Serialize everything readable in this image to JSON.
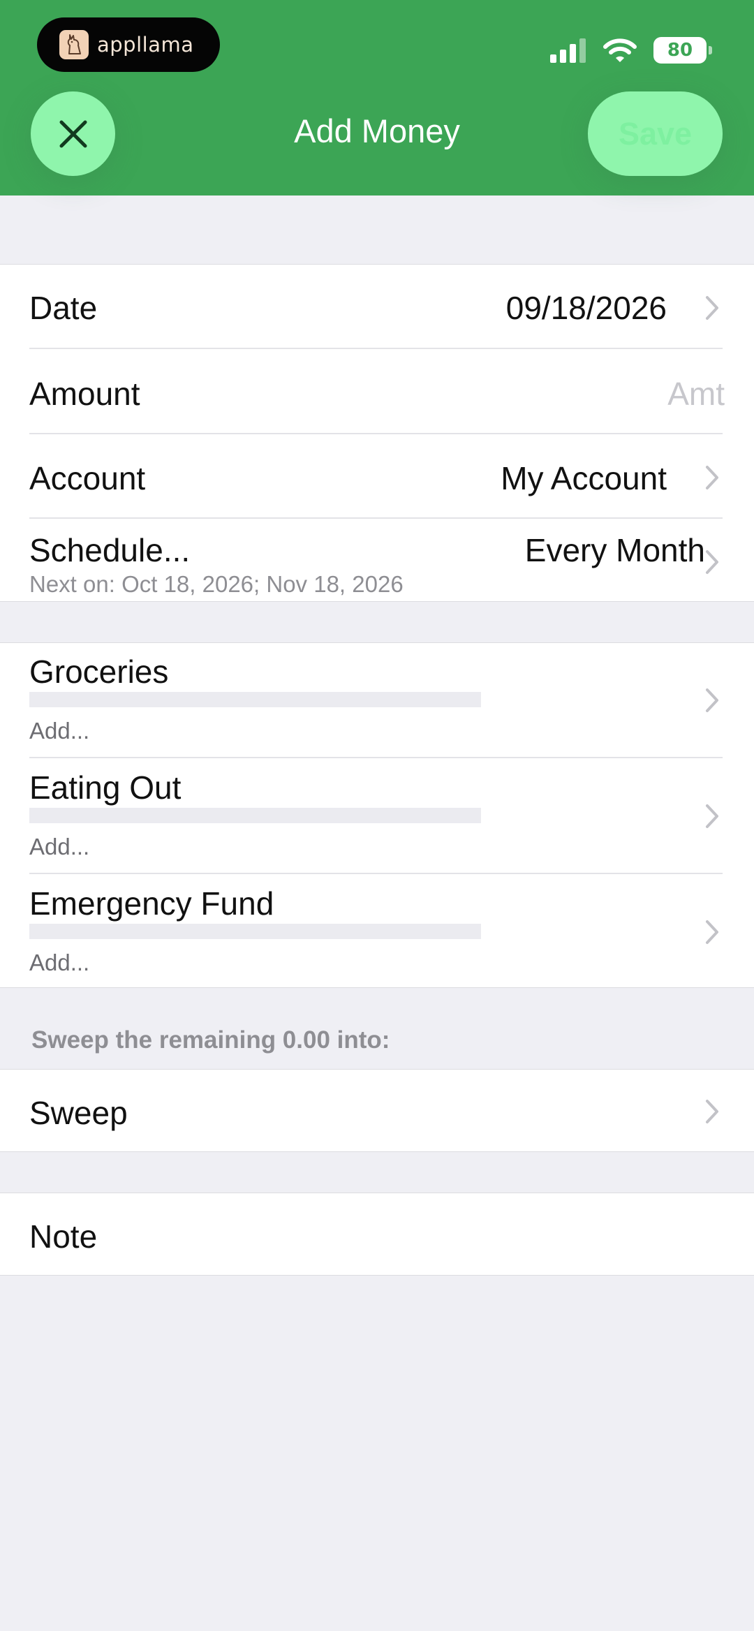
{
  "status_bar": {
    "app_badge": "appllama",
    "battery": "80"
  },
  "nav": {
    "title": "Add Money",
    "save_label": "Save"
  },
  "form": {
    "date": {
      "label": "Date",
      "value": "09/18/2026"
    },
    "amount": {
      "label": "Amount",
      "placeholder": "Amt"
    },
    "account": {
      "label": "Account",
      "value": "My Account"
    },
    "schedule": {
      "label": "Schedule...",
      "value": "Every Month",
      "next": "Next on: Oct 18, 2026; Nov 18, 2026"
    }
  },
  "envelopes": [
    {
      "name": "Groceries",
      "action": "Add..."
    },
    {
      "name": "Eating Out",
      "action": "Add..."
    },
    {
      "name": "Emergency Fund",
      "action": "Add..."
    }
  ],
  "sweep": {
    "header": "Sweep the remaining 0.00 into:",
    "label": "Sweep"
  },
  "note": {
    "label": "Note"
  },
  "colors": {
    "header_green": "#3ca555",
    "button_mint": "#8ff5ac",
    "background": "#efeff4"
  }
}
